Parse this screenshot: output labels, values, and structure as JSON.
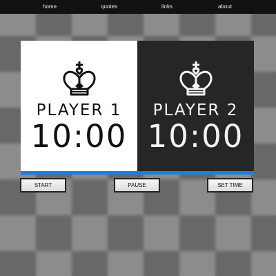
{
  "nav": {
    "links": [
      "home",
      "quotes",
      "links",
      "about"
    ]
  },
  "players": [
    {
      "label": "PLAYER 1",
      "time": "10:00"
    },
    {
      "label": "PLAYER 2",
      "time": "10:00"
    }
  ],
  "buttons": {
    "start": "START",
    "pause": "PAUSE",
    "set_time": "SET TIME"
  },
  "colors": {
    "accent": "#1e7de0",
    "nav_bg": "#111111",
    "player1_bg": "#ffffff",
    "player2_bg": "#262626"
  },
  "icons": {
    "player_icon": "chess-king-icon"
  }
}
